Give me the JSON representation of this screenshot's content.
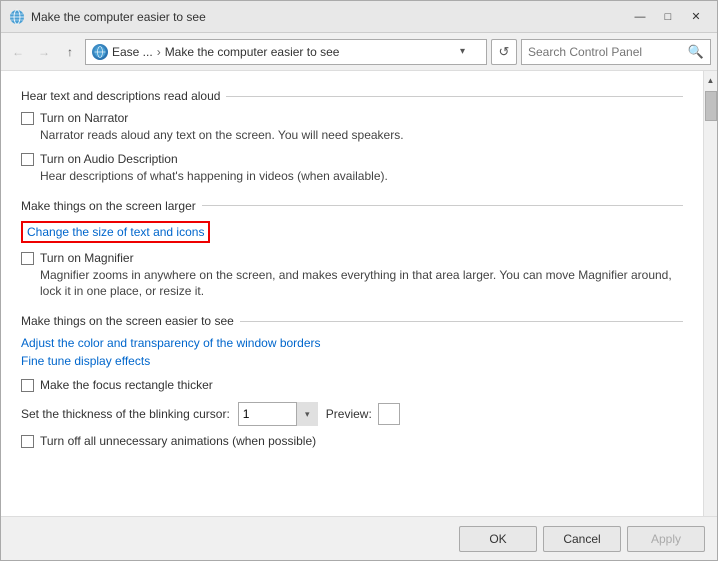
{
  "window": {
    "title": "Make the computer easier to see",
    "controls": {
      "minimize": "—",
      "maximize": "□",
      "close": "✕"
    }
  },
  "addressBar": {
    "back": "←",
    "forward": "→",
    "up": "↑",
    "path1": "Ease ...",
    "separator": "›",
    "path2": "Make the computer easier to see",
    "refresh": "↺",
    "searchPlaceholder": "Search Control Panel",
    "searchIcon": "🔍"
  },
  "sections": {
    "hear": {
      "title": "Hear text and descriptions read aloud",
      "narrator": {
        "label": "Turn on Narrator",
        "description": "Narrator reads aloud any text on the screen. You will need speakers."
      },
      "audioDesc": {
        "label": "Turn on Audio Description",
        "description": "Hear descriptions of what's happening in videos (when available)."
      }
    },
    "larger": {
      "title": "Make things on the screen larger",
      "changeLink": "Change the size of text and icons",
      "magnifier": {
        "label": "Turn on Magnifier",
        "description": "Magnifier zooms in anywhere on the screen, and makes everything in that area larger. You can move Magnifier around, lock it in one place, or resize it."
      }
    },
    "easier": {
      "title": "Make things on the screen easier to see",
      "links": [
        "Adjust the color and transparency of the window borders",
        "Fine tune display effects"
      ],
      "focusRect": {
        "label": "Make the focus rectangle thicker"
      },
      "cursorRow": {
        "label": "Set the thickness of the blinking cursor:",
        "value": "1",
        "previewLabel": "Preview:"
      },
      "animations": {
        "label": "Turn off all unnecessary animations (when possible)"
      }
    }
  },
  "buttons": {
    "ok": "OK",
    "cancel": "Cancel",
    "apply": "Apply"
  }
}
